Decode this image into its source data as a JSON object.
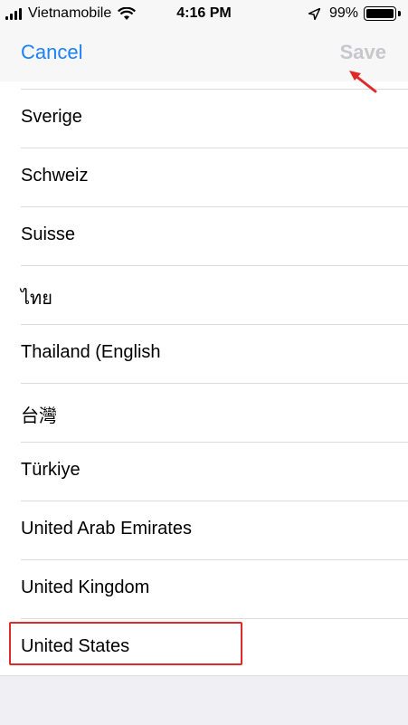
{
  "status": {
    "carrier": "Vietnamobile",
    "time": "4:16 PM",
    "battery_percent": "99%",
    "battery_level": 0.99
  },
  "nav": {
    "cancel_label": "Cancel",
    "save_label": "Save"
  },
  "regions": [
    "Sverige",
    "Schweiz",
    "Suisse",
    "ไทย",
    "Thailand (English",
    "台灣",
    "Türkiye",
    "United Arab Emirates",
    "United Kingdom",
    "United States"
  ],
  "selected_region": "United States",
  "colors": {
    "accent": "#1a82fb",
    "disabled": "#c7c7cc",
    "annotation": "#e02a2a"
  }
}
